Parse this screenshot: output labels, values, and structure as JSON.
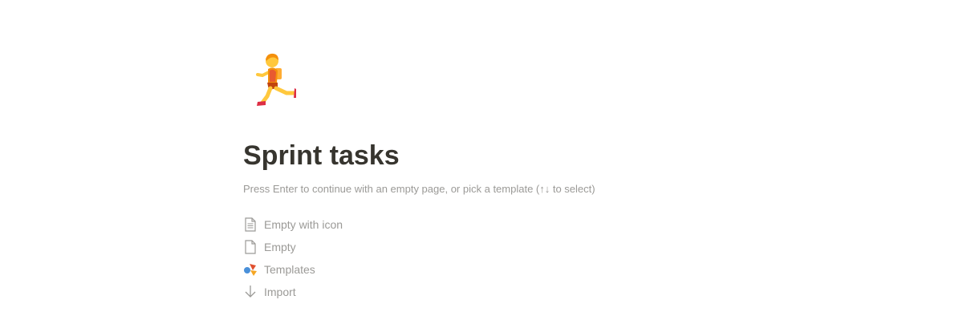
{
  "page": {
    "icon": "person-running-icon",
    "title": "Sprint tasks",
    "hint": "Press Enter to continue with an empty page, or pick a template (↑↓ to select)"
  },
  "options": [
    {
      "label": "Empty with icon",
      "icon": "page-with-lines-icon"
    },
    {
      "label": "Empty",
      "icon": "blank-page-icon"
    },
    {
      "label": "Templates",
      "icon": "templates-shapes-icon"
    },
    {
      "label": "Import",
      "icon": "download-arrow-icon"
    }
  ],
  "colors": {
    "text": "#37352f",
    "muted": "#9b9a97",
    "background": "#ffffff"
  }
}
